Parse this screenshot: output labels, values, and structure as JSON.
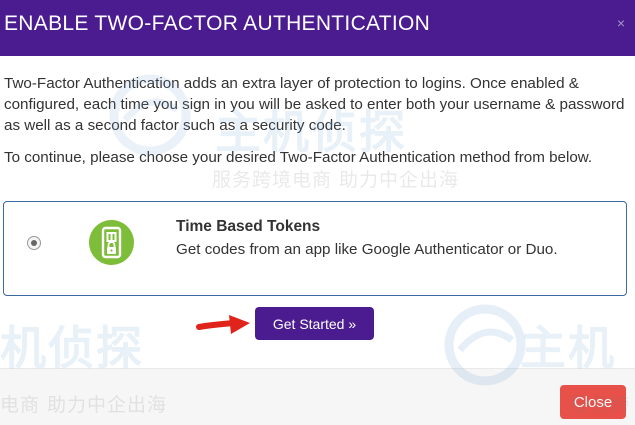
{
  "dialog": {
    "title": "ENABLE TWO-FACTOR AUTHENTICATION",
    "close_glyph": "×",
    "intro": "Two-Factor Authentication adds an extra layer of protection to logins. Once enabled & configured, each time you sign in you will be asked to enter both your username & password as well as a second factor such as a security code.",
    "instruction": "To continue, please choose your desired Two-Factor Authentication method from below."
  },
  "options": [
    {
      "title": "Time Based Tokens",
      "description": "Get codes from an app like Google Authenticator or Duo.",
      "selected": true,
      "icon": "authenticator-phone-icon",
      "icon_color": "#7dbd3a"
    }
  ],
  "actions": {
    "get_started_label": "Get Started »",
    "close_label": "Close"
  },
  "watermark": {
    "logo_text_a": "主机侦探",
    "logo_text_b": "机侦探",
    "logo_text_c": "主机",
    "tagline": "服务跨境电商 助力中企出海",
    "tagline_b": "电商 助力中企出海",
    "tagline_c": "服务跨"
  },
  "colors": {
    "header_bg": "#4b1c8f",
    "primary_button": "#4b1c8f",
    "close_button": "#e8504a",
    "option_border": "#3a6aa0",
    "arrow": "#e0241b"
  }
}
